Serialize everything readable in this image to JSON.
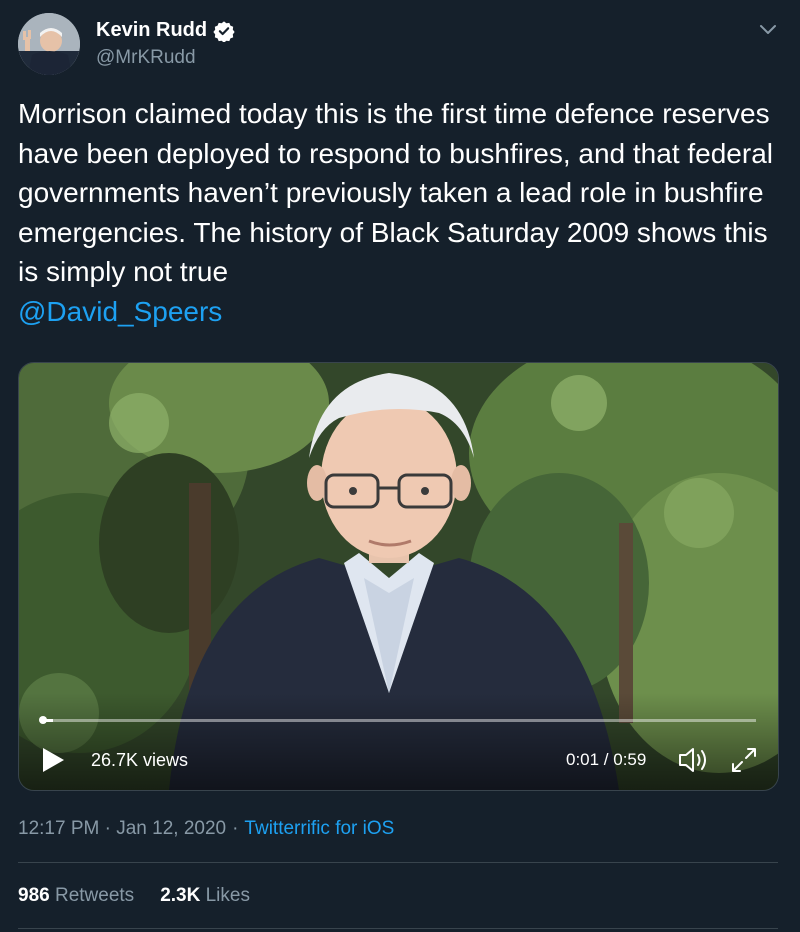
{
  "user": {
    "name": "Kevin Rudd",
    "handle": "@MrKRudd",
    "verified": true
  },
  "tweet": {
    "text": "Morrison claimed today this is the first time defence reserves have been deployed to respond to bushfires, and that federal governments haven’t previously taken a lead role in bushfire emergencies. The history of Black Saturday 2009 shows this is simply not true",
    "mention": "@David_Speers"
  },
  "video": {
    "views": "26.7K views",
    "time": "0:01 / 0:59",
    "progress": 0.017
  },
  "meta": {
    "time": "12:17 PM · Jan 12, 2020",
    "separator": "·",
    "source": "Twitterrific for iOS"
  },
  "stats": {
    "retweets_count": "986",
    "retweets_label": "Retweets",
    "likes_count": "2.3K",
    "likes_label": "Likes"
  },
  "colors": {
    "background": "#15202b",
    "link": "#1da1f2",
    "secondary_text": "#8899a6",
    "verified_badge": "#ffffff"
  }
}
